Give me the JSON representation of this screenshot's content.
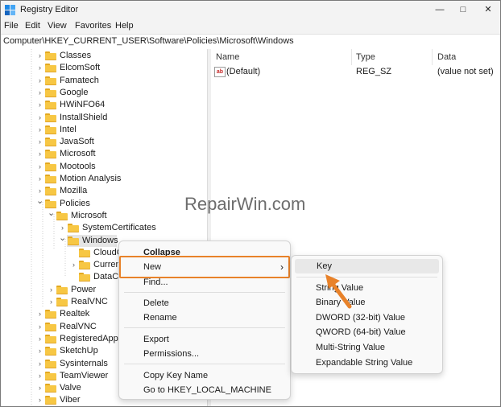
{
  "window": {
    "title": "Registry Editor",
    "minimize": "—",
    "maximize": "□",
    "close": "✕"
  },
  "menu": [
    "File",
    "Edit",
    "View",
    "Favorites",
    "Help"
  ],
  "address": "Computer\\HKEY_CURRENT_USER\\Software\\Policies\\Microsoft\\Windows",
  "tree": [
    {
      "label": "Classes",
      "level": 0,
      "chev": "right"
    },
    {
      "label": "ElcomSoft",
      "level": 0,
      "chev": "right"
    },
    {
      "label": "Famatech",
      "level": 0,
      "chev": "right"
    },
    {
      "label": "Google",
      "level": 0,
      "chev": "right"
    },
    {
      "label": "HWiNFO64",
      "level": 0,
      "chev": "right"
    },
    {
      "label": "InstallShield",
      "level": 0,
      "chev": "right"
    },
    {
      "label": "Intel",
      "level": 0,
      "chev": "right"
    },
    {
      "label": "JavaSoft",
      "level": 0,
      "chev": "right"
    },
    {
      "label": "Microsoft",
      "level": 0,
      "chev": "right"
    },
    {
      "label": "Mootools",
      "level": 0,
      "chev": "right"
    },
    {
      "label": "Motion Analysis",
      "level": 0,
      "chev": "right"
    },
    {
      "label": "Mozilla",
      "level": 0,
      "chev": "right"
    },
    {
      "label": "Policies",
      "level": 0,
      "chev": "down"
    },
    {
      "label": "Microsoft",
      "level": 1,
      "chev": "down"
    },
    {
      "label": "SystemCertificates",
      "level": 2,
      "chev": "right"
    },
    {
      "label": "Windows",
      "level": 2,
      "chev": "down",
      "selected": true
    },
    {
      "label": "CloudC",
      "level": 3,
      "chev": "none"
    },
    {
      "label": "Curren",
      "level": 3,
      "chev": "right"
    },
    {
      "label": "DataCo",
      "level": 3,
      "chev": "none"
    },
    {
      "label": "Power",
      "level": 1,
      "chev": "right"
    },
    {
      "label": "RealVNC",
      "level": 1,
      "chev": "right"
    },
    {
      "label": "Realtek",
      "level": 0,
      "chev": "right"
    },
    {
      "label": "RealVNC",
      "level": 0,
      "chev": "right"
    },
    {
      "label": "RegisteredAppli",
      "level": 0,
      "chev": "right"
    },
    {
      "label": "SketchUp",
      "level": 0,
      "chev": "right"
    },
    {
      "label": "Sysinternals",
      "level": 0,
      "chev": "right"
    },
    {
      "label": "TeamViewer",
      "level": 0,
      "chev": "right"
    },
    {
      "label": "Valve",
      "level": 0,
      "chev": "right"
    },
    {
      "label": "Viber",
      "level": 0,
      "chev": "right"
    }
  ],
  "columns": {
    "name": "Name",
    "type": "Type",
    "data": "Data"
  },
  "values": [
    {
      "name": "(Default)",
      "type": "REG_SZ",
      "data": "(value not set)"
    }
  ],
  "watermark": "RepairWin.com",
  "context_menu": {
    "items": [
      "Collapse",
      "New",
      "Find...",
      "Delete",
      "Rename",
      "Export",
      "Permissions...",
      "Copy Key Name",
      "Go to HKEY_LOCAL_MACHINE"
    ],
    "submenu_arrow": "›"
  },
  "submenu": {
    "items": [
      "Key",
      "String Value",
      "Binary Value",
      "DWORD (32-bit) Value",
      "QWORD (64-bit) Value",
      "Multi-String Value",
      "Expandable String Value"
    ]
  },
  "colors": {
    "highlight": "#e8822a",
    "folder": "#f7c744",
    "selection": "#e5e5e5"
  }
}
